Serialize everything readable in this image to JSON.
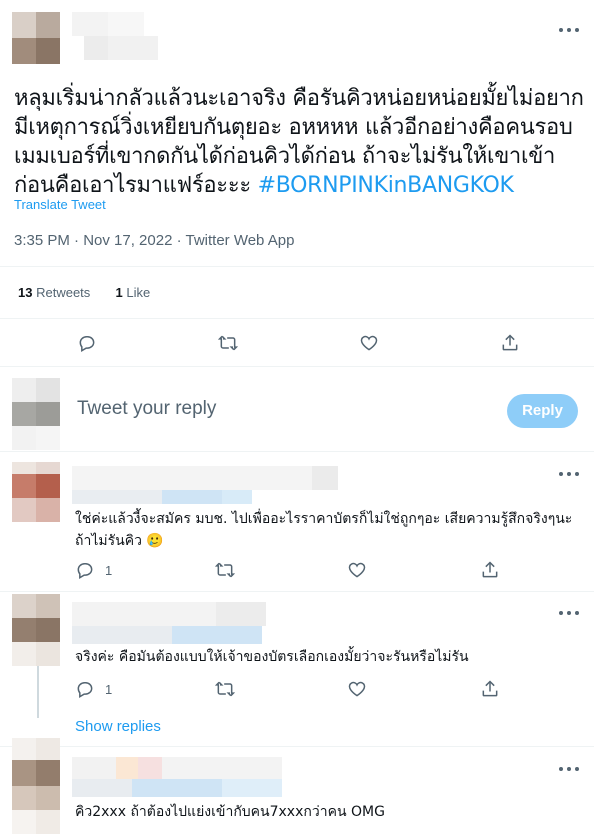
{
  "colors": {
    "accent": "#1d9bf0",
    "muted": "#536471",
    "reply_button_disabled": "#8ecdf8"
  },
  "tweet": {
    "text": "หลุมเริ่มน่ากลัวแล้วนะเอาจริง คือรันคิวหน่อยหน่อยมั้ยไม่อยากมีเหตุการณ์วิ่งเหยียบกันตุยอะ อหหหห แล้วอีกอย่างคือคนรอบเมมเบอร์ที่เขากดกันได้ก่อนคิวได้ก่อน ถ้าจะไม่รันให้เขาเข้าก่อนคือเอาไรมาแฟร์อะะะ ",
    "hashtag": "#BORNPINKinBANGKOK",
    "translate_label": "Translate Tweet",
    "meta": "3:35 PM · Nov 17, 2022 · Twitter Web App",
    "retweets_count": "13",
    "retweets_label": "Retweets",
    "likes_count": "1",
    "likes_label": "Like",
    "more_icon": "more-horizontal-icon"
  },
  "compose": {
    "placeholder": "Tweet your reply",
    "button_label": "Reply"
  },
  "replies": [
    {
      "text": "ใช่ค่ะแล้วงี้จะสมัคร มบช. ไปเพื่ออะไรราคาบัตรก็ไม่ใช่ถูกๆอะ เสียความรู้สึกจริงๆนะถ้าไม่รันคิว 🥲",
      "reply_count": "1"
    },
    {
      "text": "จริงค่ะ คือมันต้องแบบให้เจ้าของบัตรเลือกเองมั้ยว่าจะรันหรือไม่รัน",
      "reply_count": "1",
      "show_replies_label": "Show replies"
    },
    {
      "text": "คิว2xxx ถ้าต้องไปแย่งเข้ากับคน7xxxกว่าคน OMG"
    }
  ],
  "icons": [
    "reply-icon",
    "retweet-icon",
    "like-icon",
    "share-icon"
  ]
}
